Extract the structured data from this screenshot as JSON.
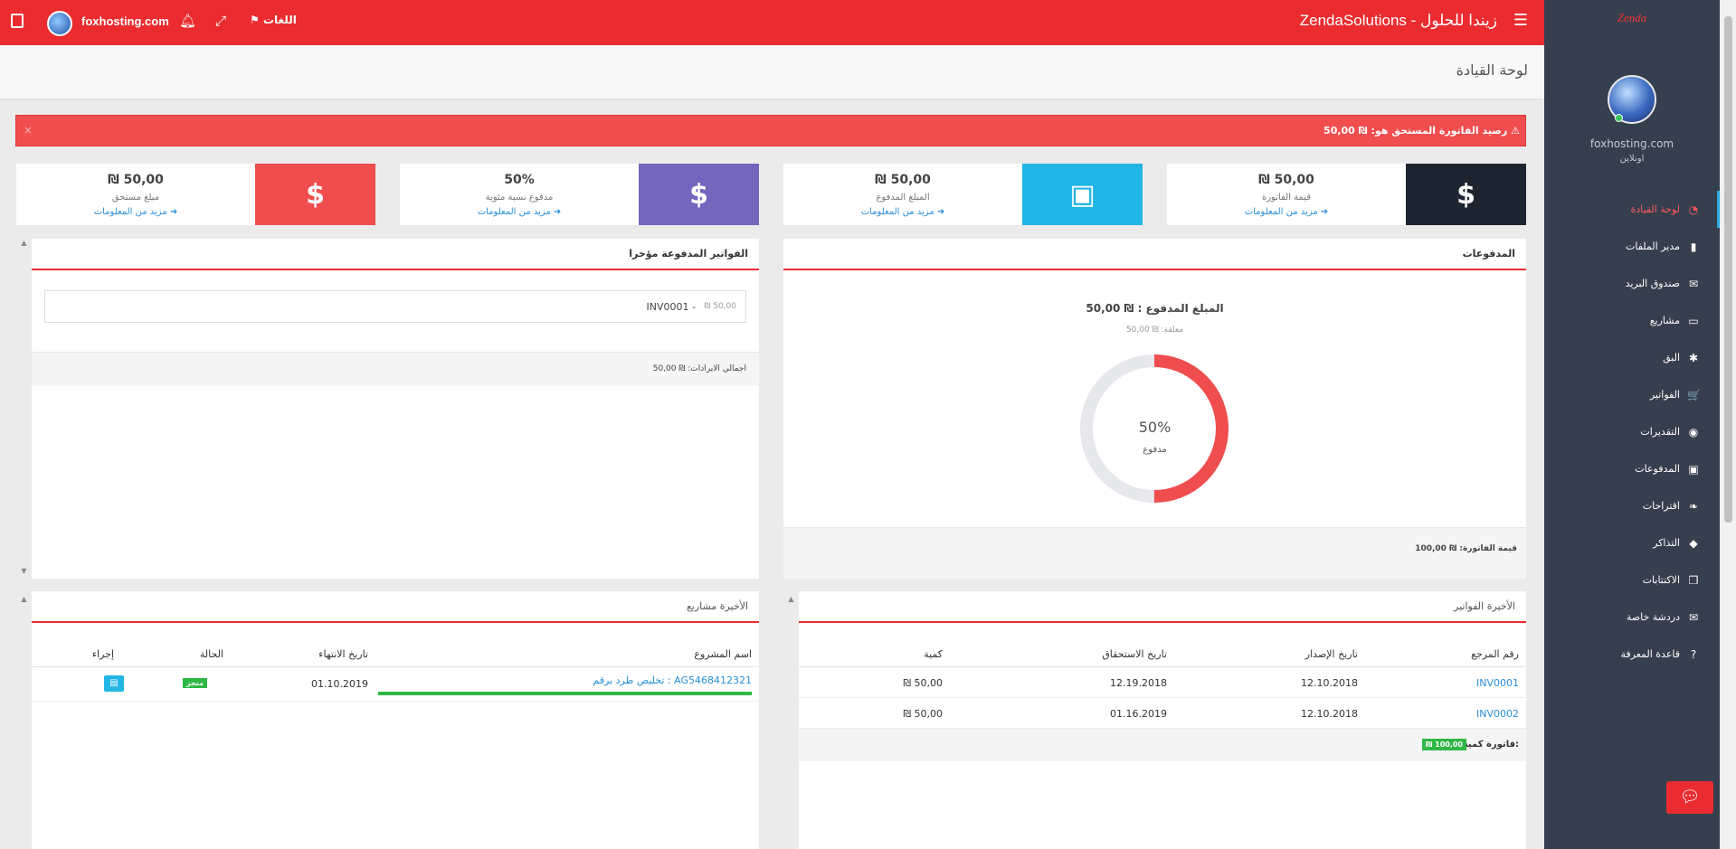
{
  "topbar": {
    "site_name": "foxhosting.com",
    "language_label": "اللغات",
    "brand": "ZendaSolutions - زيندا للحلول",
    "bell_icon": "bell",
    "expand_icon": "expand"
  },
  "sidebar": {
    "logo_text": "Zenda",
    "profile_name": "foxhosting.com",
    "profile_status": "اونلاين",
    "items": [
      {
        "label": "لوحة القيادة",
        "icon": "◔",
        "active": true
      },
      {
        "label": "مدير الملفات",
        "icon": "▮",
        "active": false
      },
      {
        "label": "صندوق البريد",
        "icon": "✉",
        "active": false
      },
      {
        "label": "مشاريع",
        "icon": "▭",
        "active": false
      },
      {
        "label": "البق",
        "icon": "✱",
        "active": false
      },
      {
        "label": "الفواتير",
        "icon": "🛒",
        "active": false
      },
      {
        "label": "التقديرات",
        "icon": "◉",
        "active": false
      },
      {
        "label": "المدفوعات",
        "icon": "▣",
        "active": false
      },
      {
        "label": "اقتراحات",
        "icon": "❧",
        "active": false
      },
      {
        "label": "التذاكر",
        "icon": "◆",
        "active": false
      },
      {
        "label": "الاكتتابات",
        "icon": "❐",
        "active": false
      },
      {
        "label": "دردشة خاصة",
        "icon": "✉",
        "active": false
      },
      {
        "label": "قاعدة المعرفة",
        "icon": "?",
        "active": false
      }
    ]
  },
  "page": {
    "title": "لوحة القيادة"
  },
  "alert": {
    "message": "رصيد الفاتورة المستحق هو: ₪ 50,00",
    "close": "×"
  },
  "stats": [
    {
      "value": "₪ 50,00",
      "label": "قيمة الفاتورة",
      "more": "مزيد من المعلومات",
      "icon": "$",
      "color": "#1d2630"
    },
    {
      "value": "₪ 50,00",
      "label": "المبلغ المدفوع",
      "more": "مزيد من المعلومات",
      "icon": "▣",
      "color": "#23b5e5"
    },
    {
      "value": "50%",
      "label": "مدفوع نسبة مئوية",
      "more": "مزيد من المعلومات",
      "icon": "$",
      "color": "#7466bd"
    },
    {
      "value": "₪ 50,00",
      "label": "مبلغ مستحق",
      "more": "مزيد من المعلومات",
      "icon": "$",
      "color": "#f04d4f"
    }
  ],
  "payments_panel": {
    "title": "المدفوعات",
    "paid_amount": "المبلغ المدفوع : ₪ 50,00",
    "pending": "معلقة: ₪ 50,00",
    "percent_text": "50%",
    "percent_sub": "مدفوع",
    "paid_fraction": 0.5,
    "footer": "قيمة الفاتورة: ₪ 100,00",
    "ring_color": "#f04d4f",
    "track_color": "#e6e8ec"
  },
  "recent_paid_panel": {
    "title": "الفواتير المدفوعة مؤخرا",
    "item_amount": "₪ 50,00",
    "item_ref": "INV0001 -",
    "footer": "اجمالي الايرادات: ₪ 50,00"
  },
  "recent_invoices_panel": {
    "title": "الأخيرة الفواتير",
    "headers": [
      "رقم المرجع",
      "تاريخ الإصدار",
      "تاريخ الاستحقاق",
      "كمية"
    ],
    "rows": [
      {
        "ref": "INV0001",
        "issued": "12.10.2018",
        "due": "12.19.2018",
        "amount": "₪ 50,00"
      },
      {
        "ref": "INV0002",
        "issued": "12.10.2018",
        "due": "01.16.2019",
        "amount": "₪ 50,00"
      }
    ],
    "total_label": "فاتورة كمية:",
    "total_value": "₪ 100,00"
  },
  "recent_projects_panel": {
    "title": "الأخيرة مشاريع",
    "headers": [
      "اسم المشروع",
      "تاريخ الانتهاء",
      "الحالة",
      "إجراء"
    ],
    "rows": [
      {
        "name": "تخليص طرد برقم : AG5468412321",
        "end": "01.10.2019",
        "status": "منجز",
        "progress": 1.0
      }
    ]
  }
}
